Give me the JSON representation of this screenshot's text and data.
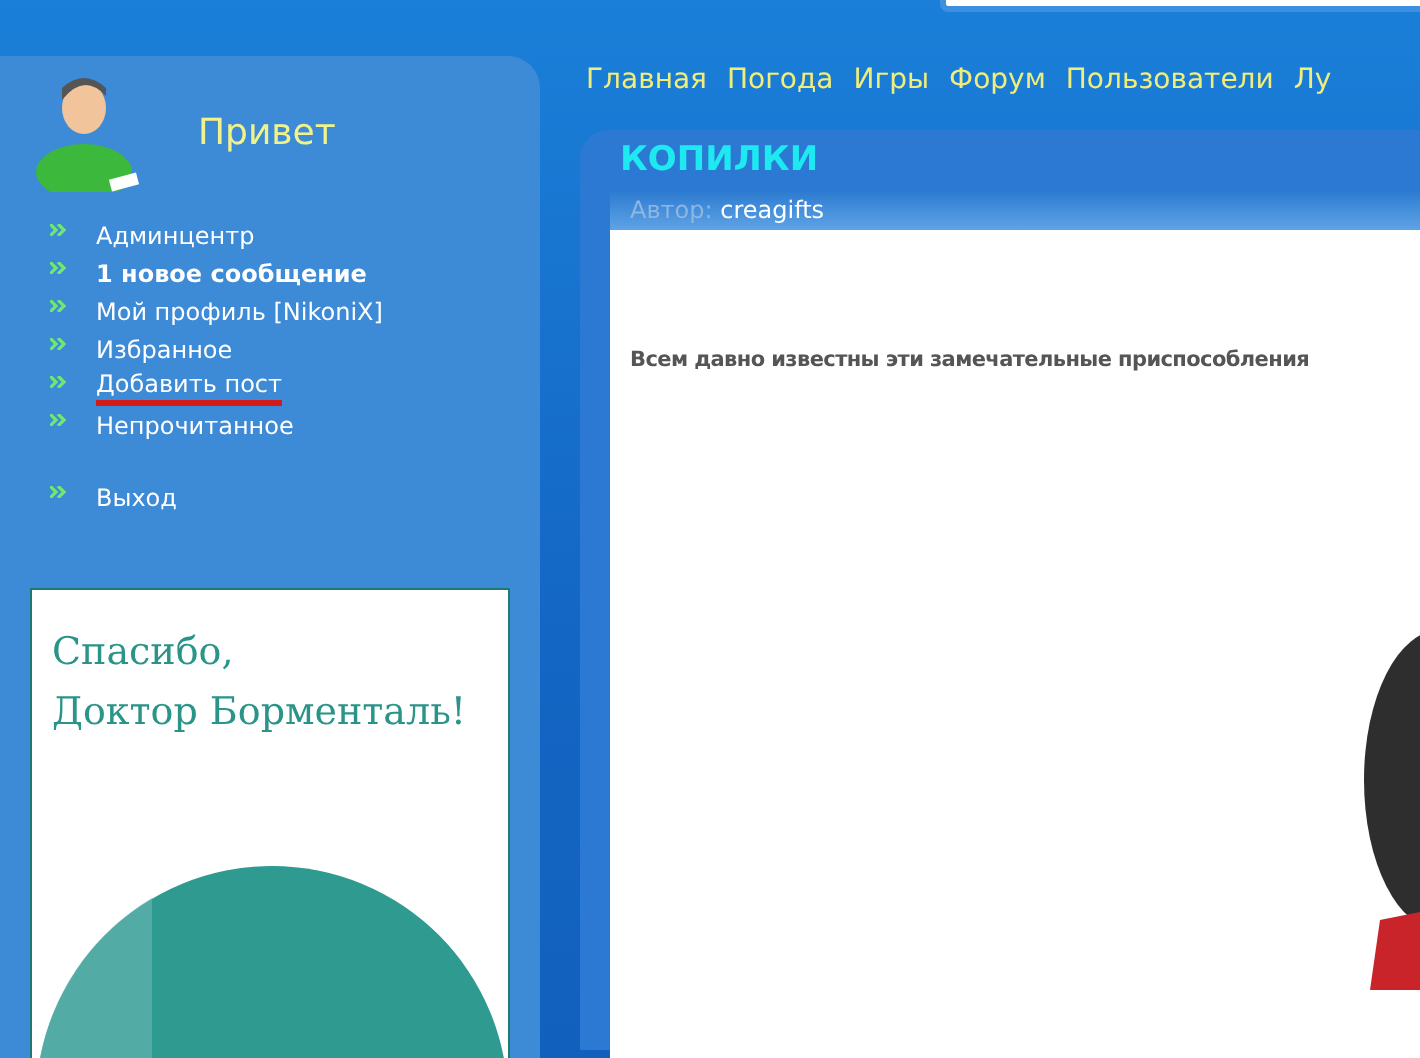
{
  "user_panel": {
    "greeting": "Привет",
    "menu": [
      {
        "label": "Админцентр",
        "bold": false,
        "underlined": false
      },
      {
        "label": "1 новое сообщение",
        "bold": true,
        "underlined": false
      },
      {
        "label": "Мой профиль [NikoniX]",
        "bold": false,
        "underlined": false
      },
      {
        "label": "Избранное",
        "bold": false,
        "underlined": false
      },
      {
        "label": "Добавить пост",
        "bold": false,
        "underlined": true
      },
      {
        "label": "Непрочитанное",
        "bold": false,
        "underlined": false
      }
    ],
    "logout": "Выход"
  },
  "banner": {
    "lines": [
      "Спасибо,",
      "Доктор Борменталь!"
    ]
  },
  "nav": [
    "Главная",
    "Погода",
    "Игры",
    "Форум",
    "Пользователи",
    "Лу"
  ],
  "post": {
    "title": "КОПИЛКИ",
    "author_label": "Автор:",
    "author": "creagifts",
    "text": "Всем давно известны эти замечательные приспособления"
  }
}
